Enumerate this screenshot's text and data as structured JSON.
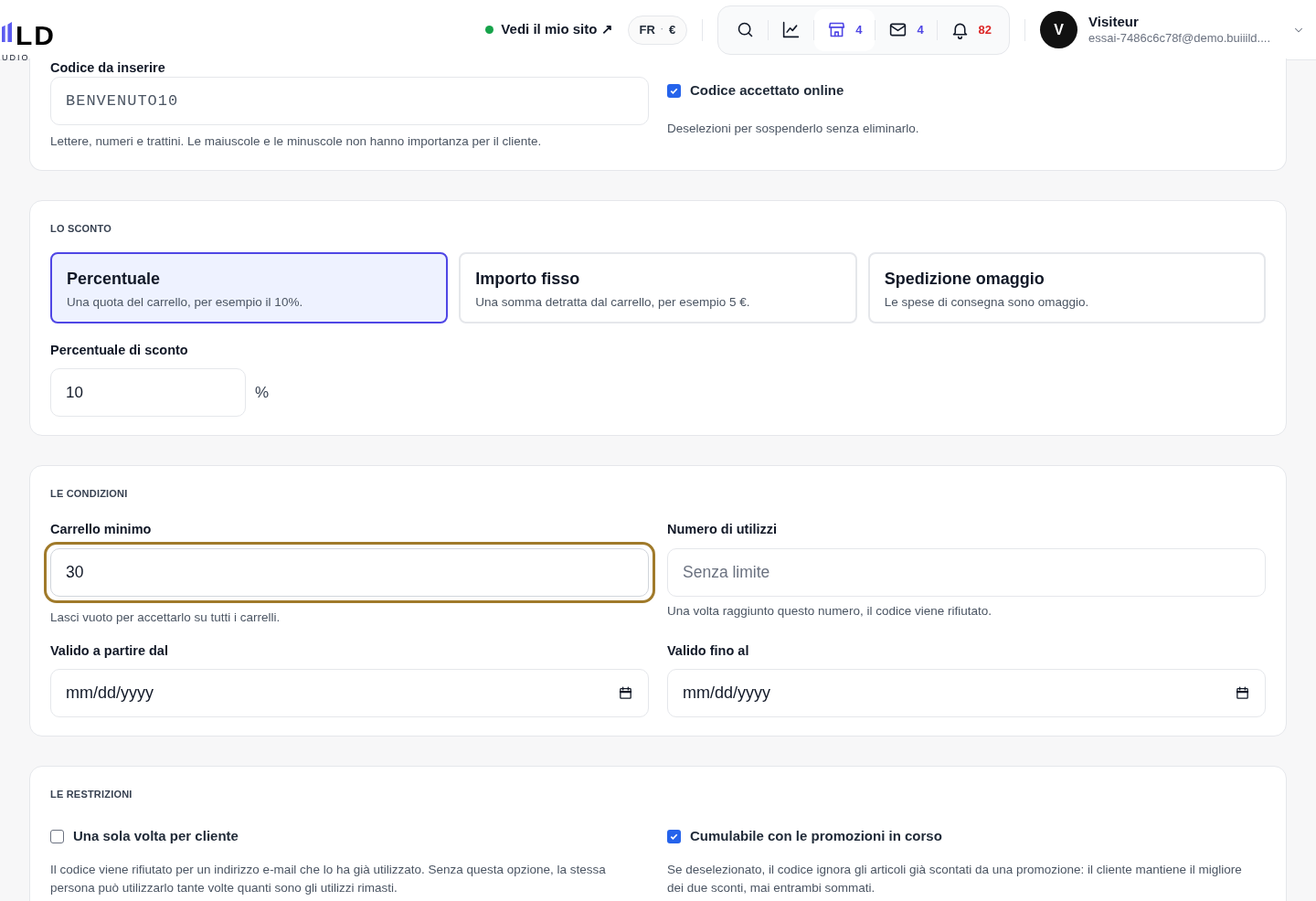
{
  "header": {
    "logo": {
      "mark": "LD",
      "sub": "UDIO"
    },
    "site_link": {
      "label": "Vedi il mio sito ↗",
      "online": true
    },
    "locale": {
      "language": "FR",
      "separator": "·",
      "currency": "€"
    },
    "toolbar": [
      {
        "kind": "search",
        "selected": false
      },
      {
        "kind": "stats",
        "selected": false
      },
      {
        "kind": "shop",
        "count": "4",
        "selected": true
      },
      {
        "kind": "mail",
        "count": "4",
        "selected": false
      },
      {
        "kind": "bell",
        "count": "82",
        "selected": false
      }
    ],
    "user": {
      "avatar": "V",
      "name": "Visiteur",
      "email": "essai-7486c6c78f@demo.buiiild...."
    }
  },
  "code_section": {
    "label": "Codice da inserire",
    "value": "BENVENUTO10",
    "hint": "Lettere, numeri e trattini. Le maiuscole e le minuscole non hanno importanza per il cliente.",
    "online": {
      "label": "Codice accettato online",
      "checked": true,
      "hint": "Deselezioni per sospenderlo senza eliminarlo."
    }
  },
  "discount": {
    "title": "LO SCONTO",
    "options": [
      {
        "title": "Percentuale",
        "description": "Una quota del carrello, per esempio il 10%.",
        "selected": true
      },
      {
        "title": "Importo fisso",
        "description": "Una somma detratta dal carrello, per esempio 5 €.",
        "selected": false
      },
      {
        "title": "Spedizione omaggio",
        "description": "Le spese di consegna sono omaggio.",
        "selected": false
      }
    ],
    "field": {
      "label": "Percentuale di sconto",
      "value": "10",
      "unit": "%"
    }
  },
  "conditions": {
    "title": "LE CONDIZIONI",
    "fields": [
      {
        "label": "Carrello minimo",
        "kind": "text",
        "value": "30",
        "focused": true,
        "hint": "Lasci vuoto per accettarlo su tutti i carrelli."
      },
      {
        "label": "Numero di utilizzi",
        "kind": "text",
        "placeholder": "Senza limite",
        "focused": false,
        "hint": "Una volta raggiunto questo numero, il codice viene rifiutato."
      },
      {
        "label": "Valido a partire dal",
        "kind": "date",
        "value": "mm/dd/yyyy",
        "focused": false
      },
      {
        "label": "Valido fino al",
        "kind": "date",
        "value": "mm/dd/yyyy",
        "focused": false
      }
    ]
  },
  "restrictions": {
    "title": "LE RESTRIZIONI",
    "options": [
      {
        "label": "Una sola volta per cliente",
        "checked": false,
        "description": "Il codice viene rifiutato per un indirizzo e-mail che lo ha già utilizzato. Senza questa opzione, la stessa persona può utilizzarlo tante volte quanti sono gli utilizzi rimasti."
      },
      {
        "label": "Cumulabile con le promozioni in corso",
        "checked": true,
        "description": "Se deselezionato, il codice ignora gli articoli già scontati da una promozione: il cliente mantiene il migliore dei due sconti, mai entrambi sommati."
      }
    ]
  }
}
